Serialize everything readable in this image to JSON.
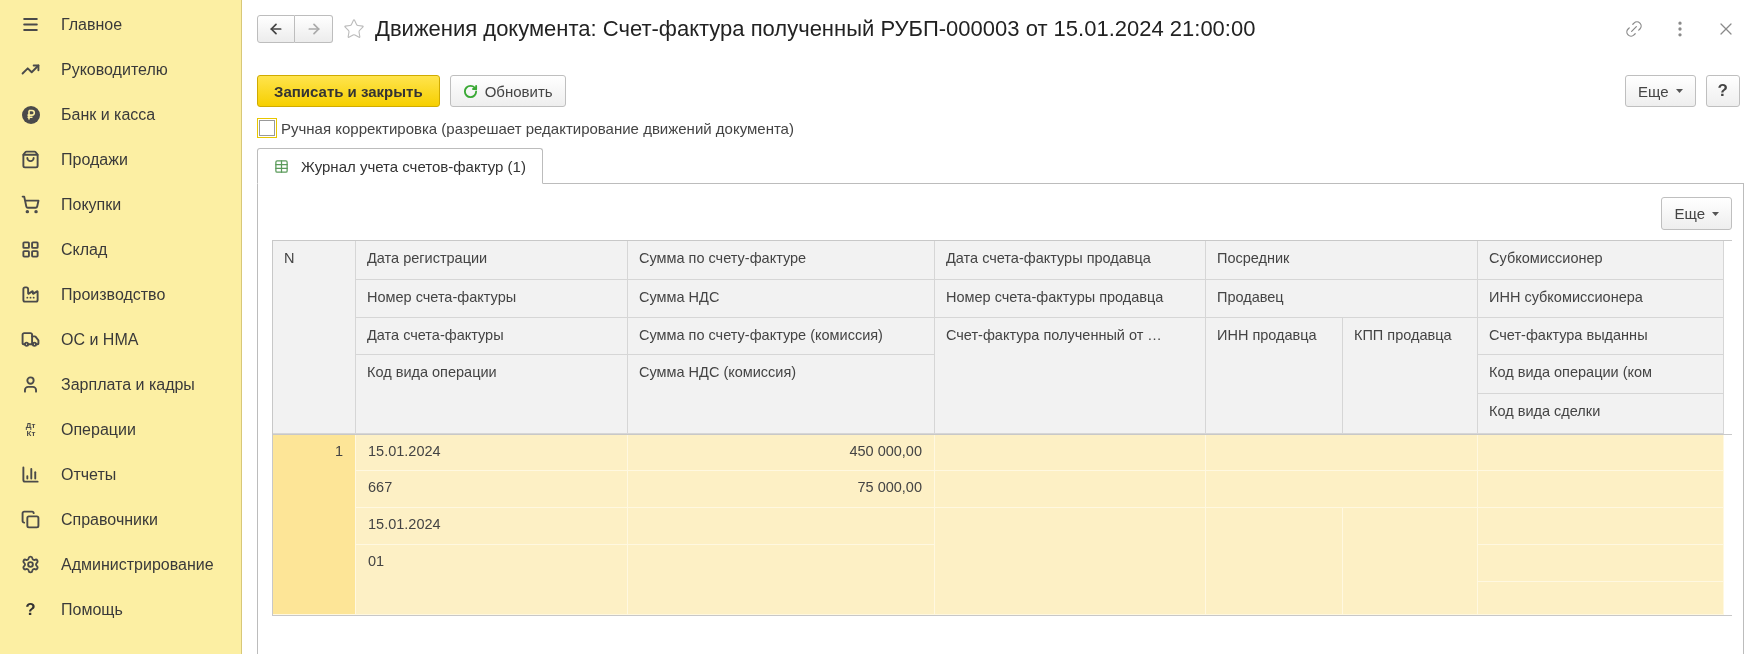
{
  "sidebar": {
    "items": [
      {
        "label": "Главное",
        "selected": false
      },
      {
        "label": "Руководителю",
        "selected": false
      },
      {
        "label": "Банк и касса",
        "selected": false
      },
      {
        "label": "Продажи",
        "selected": false
      },
      {
        "label": "Покупки",
        "selected": false
      },
      {
        "label": "Склад",
        "selected": false
      },
      {
        "label": "Производство",
        "selected": false
      },
      {
        "label": "ОС и НМА",
        "selected": false
      },
      {
        "label": "Зарплата и кадры",
        "selected": false
      },
      {
        "label": "Операции",
        "selected": false,
        "icon_text": [
          "Дт",
          "Кт"
        ]
      },
      {
        "label": "Отчеты",
        "selected": false
      },
      {
        "label": "Справочники",
        "selected": false
      },
      {
        "label": "Администрирование",
        "selected": false
      },
      {
        "label": "Помощь",
        "selected": false,
        "icon_text": [
          "?"
        ]
      }
    ]
  },
  "window": {
    "title": "Движения документа: Счет-фактура полученный РУБП-000003 от 15.01.2024 21:00:00",
    "favorite": false
  },
  "toolbar": {
    "save_button": "Записать и закрыть",
    "refresh_button": "Обновить",
    "more_button": "Еще",
    "help_button": "?"
  },
  "manual_edit": {
    "label": "Ручная корректировка (разрешает редактирование движений документа)",
    "checked": false
  },
  "tabs": [
    {
      "label": "Журнал учета счетов-фактур (1)",
      "selected": true
    }
  ],
  "table": {
    "more_button": "Еще",
    "header": {
      "number": "N",
      "groups": [
        [
          "Дата регистрации",
          "Номер счета-фактуры",
          "Дата счета-фактуры",
          "Код вида операции"
        ],
        [
          "Сумма по счету-фактуре",
          "Сумма НДС",
          "Сумма по счету-фактуре (комиссия)",
          "Сумма НДС (комиссия)"
        ],
        [
          "Дата счета-фактуры продавца",
          "Номер счета-фактуры продавца",
          "Счет-фактура полученный от …"
        ],
        [
          "Посредник",
          "Продавец",
          "ИНН продавца",
          "КПП продавца"
        ],
        [
          "Субкомиссионер",
          "ИНН субкомиссионера",
          "Счет-фактура выданны",
          "Код вида операции (ком",
          "Код вида сделки"
        ]
      ]
    },
    "rows": [
      {
        "number": "1",
        "selected": true,
        "cells": [
          [
            "15.01.2024",
            "667",
            "15.01.2024",
            "01"
          ],
          [
            "450 000,00",
            "75 000,00"
          ]
        ]
      }
    ]
  }
}
